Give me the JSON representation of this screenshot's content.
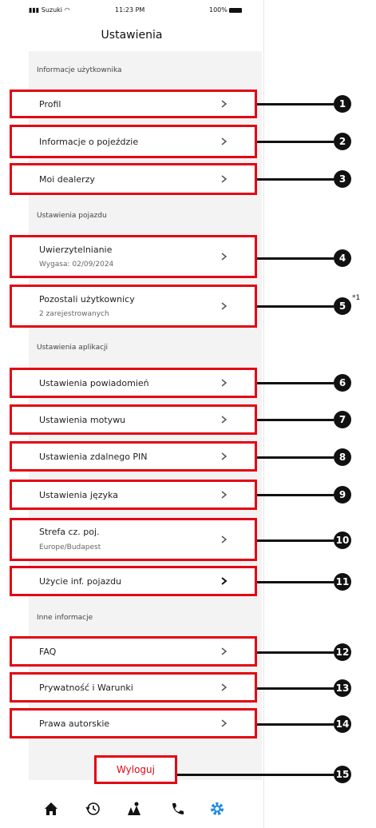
{
  "status_bar": {
    "carrier": "Suzuki",
    "time": "11:23 PM",
    "battery": "100%"
  },
  "header": {
    "title": "Ustawienia"
  },
  "sections": {
    "user_info": "Informacje użytkownika",
    "vehicle_settings": "Ustawienia pojazdu",
    "app_settings": "Ustawienia aplikacji",
    "other_info": "Inne informacje"
  },
  "items": [
    {
      "label": "Profil",
      "number": "1"
    },
    {
      "label": "Informacje o pojeździe",
      "number": "2"
    },
    {
      "label": "Moi dealerzy",
      "number": "3"
    },
    {
      "label": "Uwierzytelnianie",
      "sub": "Wygasa: 02/09/2024",
      "number": "4"
    },
    {
      "label": "Pozostali użytkownicy",
      "sub": "2 zarejestrowanych",
      "number": "5",
      "footnote": "*1"
    },
    {
      "label": "Ustawienia powiadomień",
      "number": "6"
    },
    {
      "label": "Ustawienia motywu",
      "number": "7"
    },
    {
      "label": "Ustawienia zdalnego PIN",
      "number": "8"
    },
    {
      "label": "Ustawienia języka",
      "number": "9"
    },
    {
      "label": "Strefa cz. poj.",
      "sub": "Europe/Budapest",
      "number": "10"
    },
    {
      "label": "Użycie inf. pojazdu",
      "number": "11"
    },
    {
      "label": "FAQ",
      "number": "12"
    },
    {
      "label": "Prywatność i Warunki",
      "number": "13"
    },
    {
      "label": "Prawa autorskie",
      "number": "14"
    }
  ],
  "logout": {
    "label": "Wyloguj",
    "number": "15"
  },
  "tabbar": {
    "icons": [
      "home-icon",
      "history-icon",
      "map-icon",
      "phone-icon",
      "settings-icon"
    ],
    "active_color": "#1e88e5"
  },
  "colors": {
    "accent": "#e30613",
    "callout": "#111111"
  }
}
